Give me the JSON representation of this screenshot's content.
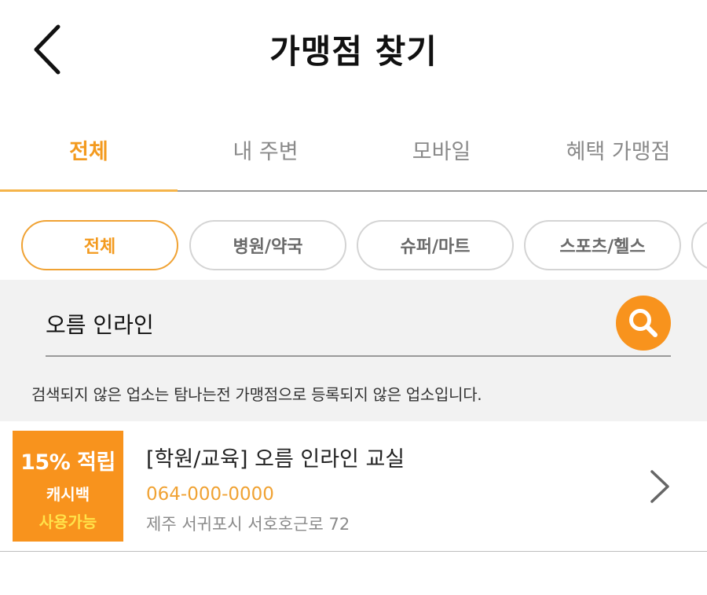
{
  "header": {
    "title": "가맹점 찾기",
    "back_icon": "chevron-left-icon"
  },
  "tabs": [
    {
      "label": "전체",
      "active": true
    },
    {
      "label": "내 주변",
      "active": false
    },
    {
      "label": "모바일",
      "active": false
    },
    {
      "label": "혜택 가맹점",
      "active": false
    }
  ],
  "categories": [
    {
      "label": "전체",
      "active": true
    },
    {
      "label": "병원/약국",
      "active": false
    },
    {
      "label": "슈퍼/마트",
      "active": false
    },
    {
      "label": "스포츠/헬스",
      "active": false
    }
  ],
  "search": {
    "value": "오름 인라인",
    "icon": "search-icon",
    "notice": "검색되지 않은 업소는 탐나는전 가맹점으로 등록되지 않은 업소입니다."
  },
  "results": [
    {
      "badge": {
        "rate": "15% 적립",
        "cashback": "캐시백",
        "usable": "사용가능"
      },
      "name": "[학원/교육] 오름 인라인 교실",
      "phone": "064-000-0000",
      "address": "제주 서귀포시 서호호근로 72"
    }
  ],
  "colors": {
    "accent": "#f8931d",
    "accent_text": "#f39a1e",
    "badge_highlight": "#ffe24a"
  }
}
